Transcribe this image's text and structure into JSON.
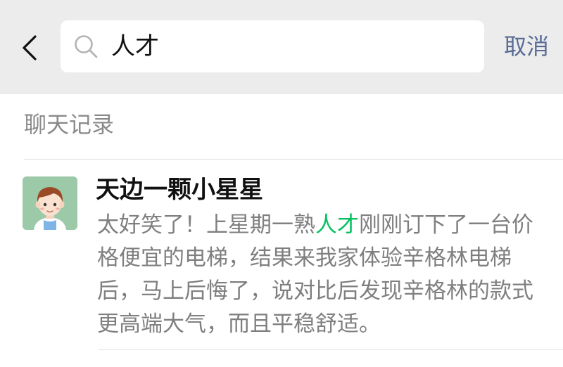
{
  "header": {
    "back_icon": "chevron-left-icon",
    "search": {
      "icon": "search-icon",
      "value": "人才",
      "placeholder": ""
    },
    "cancel_label": "取消",
    "colors": {
      "background": "#ececec",
      "cancel": "#576b95"
    }
  },
  "section": {
    "title": "聊天记录"
  },
  "results": [
    {
      "name": "天边一颗小星星",
      "avatar": "cartoon-boy-avatar",
      "snippet_before": "太好笑了！上星期一熟",
      "snippet_match": "人才",
      "snippet_after": "刚刚订下了一台价格便宜的电梯，结果来我家体验辛格林电梯后，马上后悔了，说对比后发现辛格林的款式更高端大气，而且平稳舒适。",
      "highlight_color": "#07c160"
    }
  ]
}
